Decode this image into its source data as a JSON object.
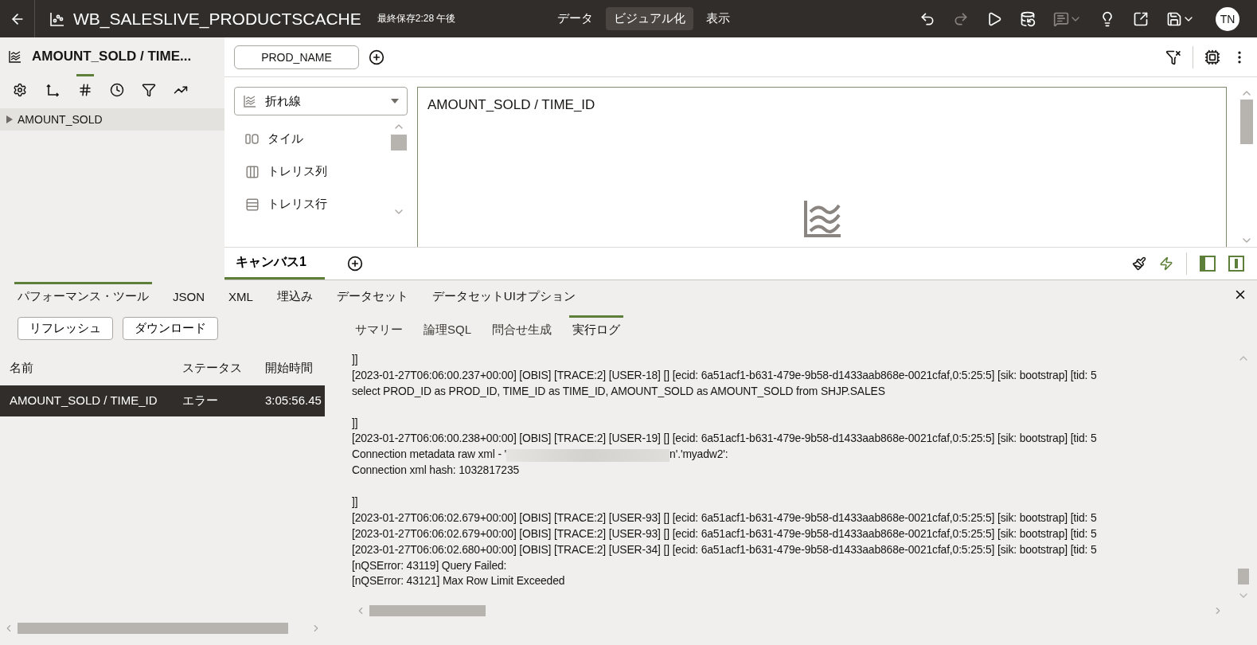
{
  "header": {
    "title": "WB_SALESLIVE_PRODUCTSCACHE",
    "saved": "最終保存2:28 午後",
    "avatar": "TN",
    "nav_tabs": [
      {
        "label": "データ",
        "selected": false
      },
      {
        "label": "ビジュアル化",
        "selected": true
      },
      {
        "label": "表示",
        "selected": false
      }
    ],
    "actions": [
      {
        "kind": "undo",
        "disabled": false
      },
      {
        "kind": "redo",
        "disabled": true
      },
      {
        "kind": "play",
        "disabled": false
      },
      {
        "kind": "refresh-data",
        "disabled": false
      },
      {
        "kind": "comment",
        "disabled": true
      },
      {
        "kind": "insight",
        "disabled": false
      },
      {
        "kind": "export",
        "disabled": false
      },
      {
        "kind": "save",
        "disabled": false
      }
    ]
  },
  "left_panel": {
    "title": "AMOUNT_SOLD / TIME...",
    "tools": [
      {
        "kind": "settings",
        "selected": false
      },
      {
        "kind": "axis",
        "selected": false
      },
      {
        "kind": "number",
        "selected": true
      },
      {
        "kind": "time",
        "selected": false
      },
      {
        "kind": "filter",
        "selected": false
      },
      {
        "kind": "trend",
        "selected": false
      }
    ],
    "tree": [
      {
        "label": "AMOUNT_SOLD",
        "expanded": false
      }
    ]
  },
  "grammar": {
    "chips": [
      "PROD_NAME"
    ]
  },
  "chart_type": {
    "value": "折れ線",
    "options": [
      {
        "kind": "tile",
        "label": "タイル"
      },
      {
        "kind": "columns",
        "label": "トレリス列"
      },
      {
        "kind": "rows",
        "label": "トレリス行"
      }
    ]
  },
  "canvas": {
    "title": "AMOUNT_SOLD / TIME_ID"
  },
  "canvas_tabs": [
    {
      "label": "キャンバス1",
      "selected": true
    }
  ],
  "devtools": {
    "tabs": [
      {
        "label": "パフォーマンス・ツール",
        "selected": true
      },
      {
        "label": "JSON",
        "selected": false
      },
      {
        "label": "XML",
        "selected": false
      },
      {
        "label": "埋込み",
        "selected": false
      },
      {
        "label": "データセット",
        "selected": false
      },
      {
        "label": "データセットUIオプション",
        "selected": false
      }
    ],
    "buttons": [
      "リフレッシュ",
      "ダウンロード"
    ],
    "columns": [
      "名前",
      "ステータス",
      "開始時間"
    ],
    "rows": [
      {
        "cells": [
          "AMOUNT_SOLD / TIME_ID",
          "エラー",
          "3:05:56.45"
        ],
        "selected": true
      }
    ],
    "log_tabs": [
      {
        "label": "サマリー",
        "selected": false
      },
      {
        "label": "論理SQL",
        "selected": false
      },
      {
        "label": "問合せ生成",
        "selected": false
      },
      {
        "label": "実行ログ",
        "selected": true
      }
    ],
    "log": [
      {
        "kind": "text",
        "text": "]]"
      },
      {
        "kind": "text",
        "text": "[2023-01-27T06:06:00.237+00:00] [OBIS] [TRACE:2] [USER-18] [] [ecid: 6a51acf1-b631-479e-9b58-d1433aab868e-0021cfaf,0:5:25:5] [sik: bootstrap] [tid: 5"
      },
      {
        "kind": "text",
        "text": "select PROD_ID as PROD_ID, TIME_ID as TIME_ID, AMOUNT_SOLD as AMOUNT_SOLD from SHJP.SALES"
      },
      {
        "kind": "blank"
      },
      {
        "kind": "text",
        "text": "]]"
      },
      {
        "kind": "text",
        "text": "[2023-01-27T06:06:00.238+00:00] [OBIS] [TRACE:2] [USER-19] [] [ecid: 6a51acf1-b631-479e-9b58-d1433aab868e-0021cfaf,0:5:25:5] [sik: bootstrap] [tid: 5"
      },
      {
        "kind": "redacted",
        "before": "Connection metadata raw xml - '",
        "after": "n'.'myadw2':"
      },
      {
        "kind": "text",
        "text": "Connection xml hash: 1032817235"
      },
      {
        "kind": "blank"
      },
      {
        "kind": "text",
        "text": "]]"
      },
      {
        "kind": "text",
        "text": "[2023-01-27T06:06:02.679+00:00] [OBIS] [TRACE:2] [USER-93] [] [ecid: 6a51acf1-b631-479e-9b58-d1433aab868e-0021cfaf,0:5:25:5] [sik: bootstrap] [tid: 5"
      },
      {
        "kind": "text",
        "text": "[2023-01-27T06:06:02.679+00:00] [OBIS] [TRACE:2] [USER-93] [] [ecid: 6a51acf1-b631-479e-9b58-d1433aab868e-0021cfaf,0:5:25:5] [sik: bootstrap] [tid: 5"
      },
      {
        "kind": "text",
        "text": "[2023-01-27T06:06:02.680+00:00] [OBIS] [TRACE:2] [USER-34] [] [ecid: 6a51acf1-b631-479e-9b58-d1433aab868e-0021cfaf,0:5:25:5] [sik: bootstrap] [tid: 5"
      },
      {
        "kind": "text",
        "text": "[nQSError: 43119] Query Failed:"
      },
      {
        "kind": "text",
        "text": "[nQSError: 43121] Max Row Limit Exceeded"
      }
    ]
  }
}
